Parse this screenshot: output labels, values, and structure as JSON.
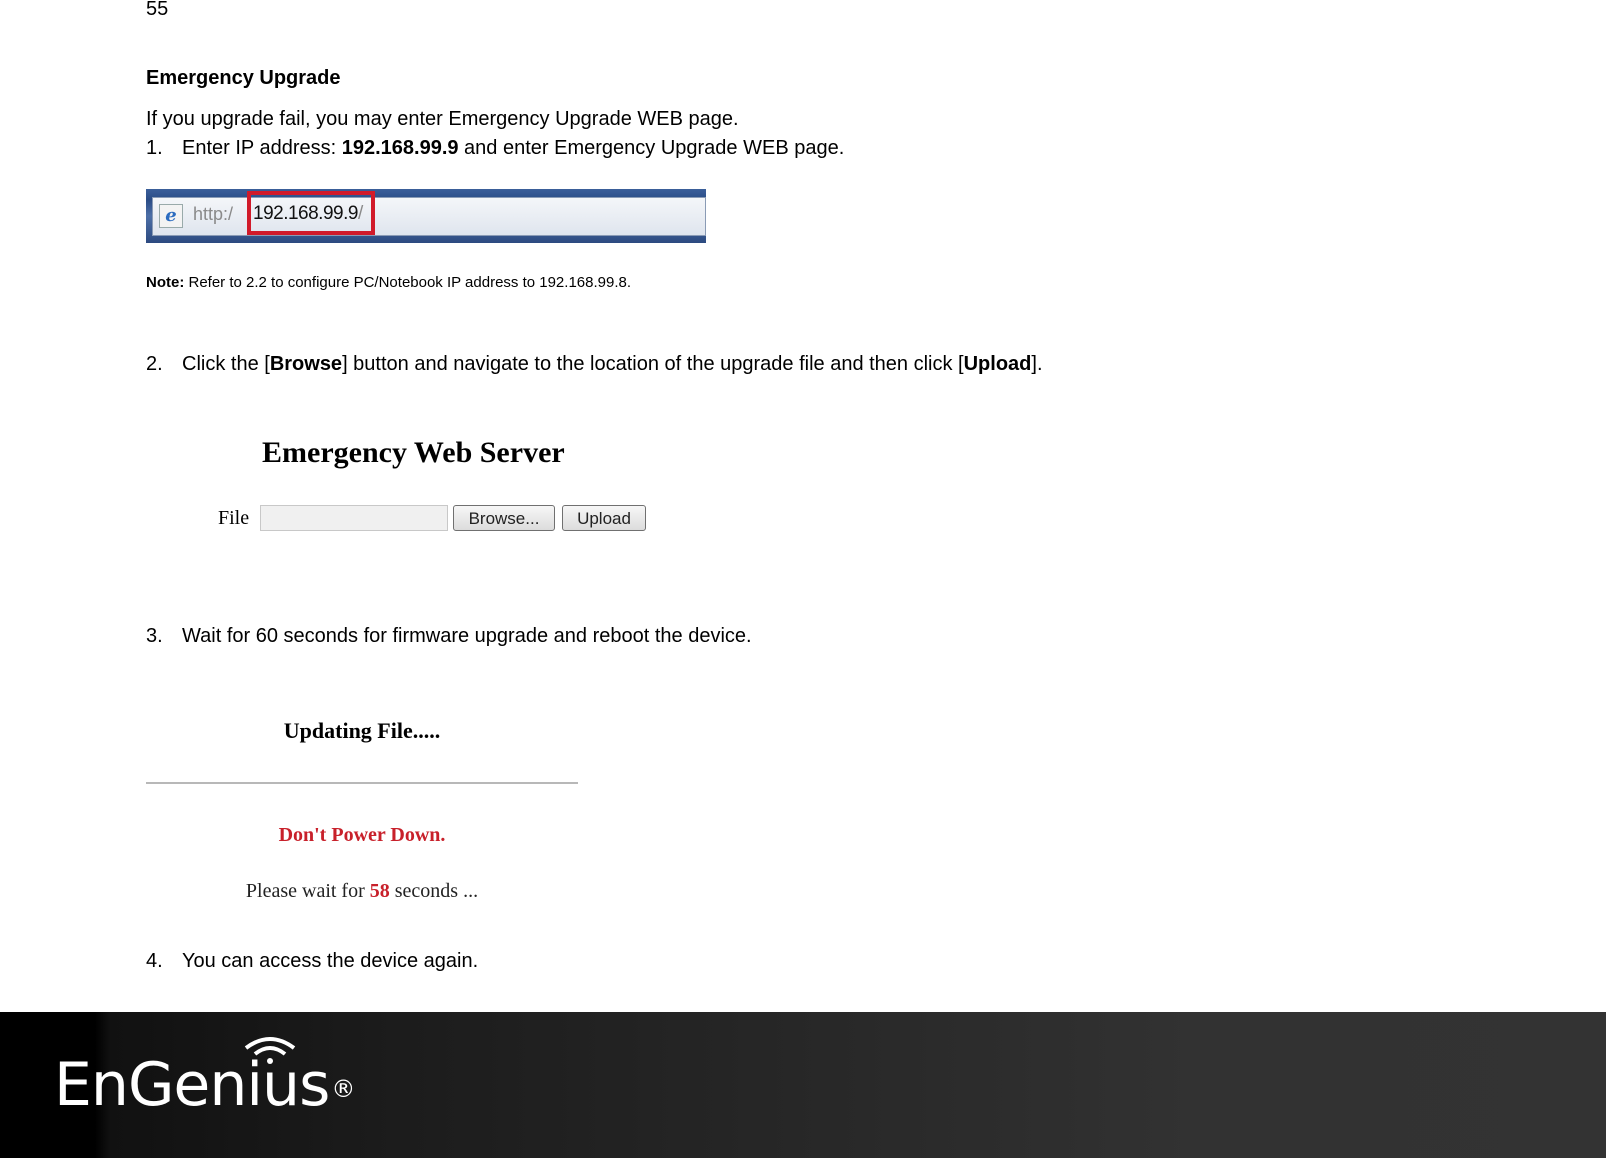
{
  "page": {
    "number": "55",
    "section_title": "Emergency Upgrade",
    "intro": "If you upgrade fail, you may enter Emergency Upgrade WEB page."
  },
  "steps": [
    {
      "num": "1.",
      "pre": "Enter IP address: ",
      "bold": "192.168.99.9",
      "post": " and enter Emergency Upgrade WEB page."
    },
    {
      "num": "2.",
      "pre": "Click the [",
      "bold": "Browse",
      "mid": "] button and navigate to the location of the upgrade file and then click [",
      "bold2": "Upload",
      "post": "]."
    },
    {
      "num": "3.",
      "text": "Wait for 60 seconds for firmware upgrade and reboot the device."
    },
    {
      "num": "4.",
      "text": "You can access the device again."
    }
  ],
  "address_bar": {
    "browser_icon": "ie-icon",
    "scheme": "http:/",
    "ip": "192.168.99.9",
    "slash": "/",
    "highlight_color": "#d11a2a"
  },
  "note": {
    "label": "Note:",
    "text": " Refer to 2.2 to configure PC/Notebook IP address to 192.168.99.8."
  },
  "emergency_server": {
    "title": "Emergency Web Server",
    "file_label": "File",
    "file_value": "",
    "browse_label": "Browse...",
    "upload_label": "Upload"
  },
  "updating": {
    "title": "Updating File.....",
    "warning": "Don't Power Down.",
    "wait_pre": "Please wait for ",
    "wait_seconds": "58",
    "wait_post": " seconds ...",
    "accent_color": "#c8202a"
  },
  "footer": {
    "brand": "EnGenius",
    "registered": "®",
    "logo_icon": "wifi-icon"
  }
}
